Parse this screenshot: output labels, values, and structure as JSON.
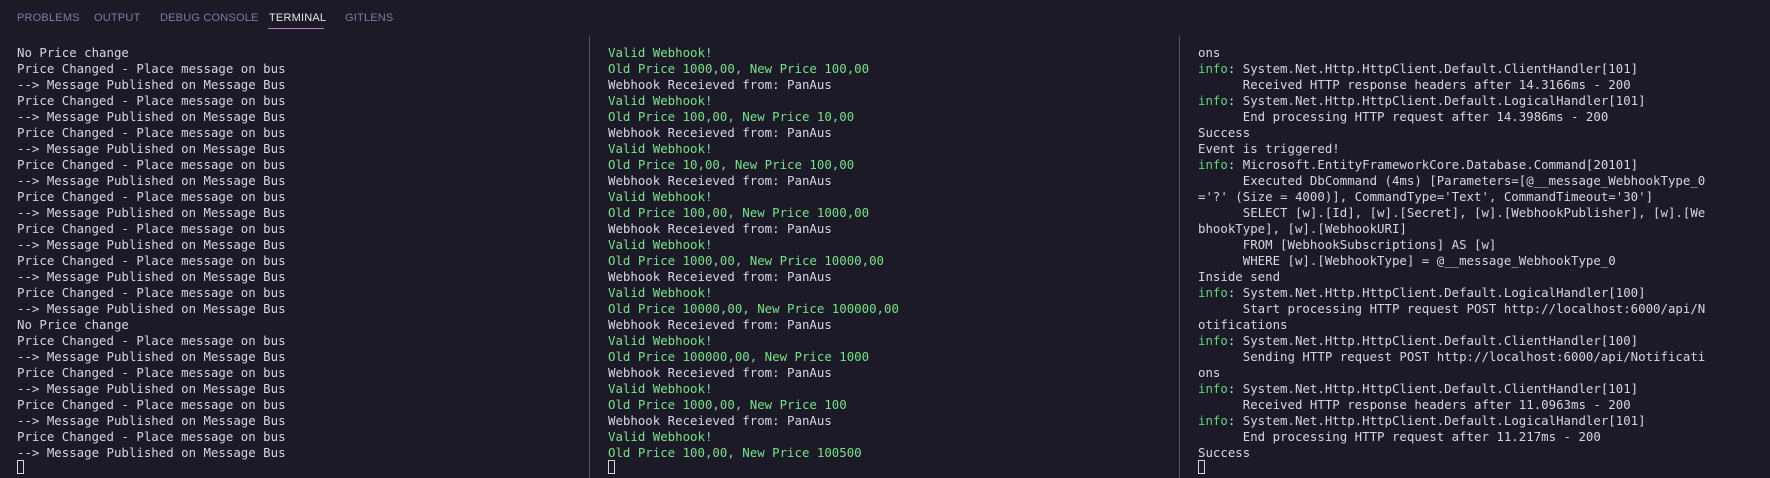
{
  "tabs": [
    {
      "label": "PROBLEMS"
    },
    {
      "label": "OUTPUT"
    },
    {
      "label": "DEBUG CONSOLE"
    },
    {
      "label": "TERMINAL"
    },
    {
      "label": "GITLENS"
    }
  ],
  "active_tab": "TERMINAL",
  "colors": {
    "background": "#1b1a26",
    "text": "#d6d6e0",
    "success_text": "#79e08a",
    "log_level": "#62d67a",
    "tab_inactive": "#7a7fa8",
    "tab_active": "#e8e8f0",
    "tab_underline": "#c66fd6",
    "divider": "#56516e"
  },
  "terminals": [
    {
      "lines": [
        {
          "text": "No Price change"
        },
        {
          "text": "Price Changed - Place message on bus"
        },
        {
          "text": "--> Message Published on Message Bus"
        },
        {
          "text": "Price Changed - Place message on bus"
        },
        {
          "text": "--> Message Published on Message Bus"
        },
        {
          "text": "Price Changed - Place message on bus"
        },
        {
          "text": "--> Message Published on Message Bus"
        },
        {
          "text": "Price Changed - Place message on bus"
        },
        {
          "text": "--> Message Published on Message Bus"
        },
        {
          "text": "Price Changed - Place message on bus"
        },
        {
          "text": "--> Message Published on Message Bus"
        },
        {
          "text": "Price Changed - Place message on bus"
        },
        {
          "text": "--> Message Published on Message Bus"
        },
        {
          "text": "Price Changed - Place message on bus"
        },
        {
          "text": "--> Message Published on Message Bus"
        },
        {
          "text": "Price Changed - Place message on bus"
        },
        {
          "text": "--> Message Published on Message Bus"
        },
        {
          "text": "No Price change"
        },
        {
          "text": "Price Changed - Place message on bus"
        },
        {
          "text": "--> Message Published on Message Bus"
        },
        {
          "text": "Price Changed - Place message on bus"
        },
        {
          "text": "--> Message Published on Message Bus"
        },
        {
          "text": "Price Changed - Place message on bus"
        },
        {
          "text": "--> Message Published on Message Bus"
        },
        {
          "text": "Price Changed - Place message on bus"
        },
        {
          "text": "--> Message Published on Message Bus"
        }
      ]
    },
    {
      "lines": [
        {
          "text": "Valid Webhook!",
          "style": "green"
        },
        {
          "text": "Old Price 1000,00, New Price 100,00",
          "style": "green"
        },
        {
          "text": "Webhook Receieved from: PanAus"
        },
        {
          "text": "Valid Webhook!",
          "style": "green"
        },
        {
          "text": "Old Price 100,00, New Price 10,00",
          "style": "green"
        },
        {
          "text": "Webhook Receieved from: PanAus"
        },
        {
          "text": "Valid Webhook!",
          "style": "green"
        },
        {
          "text": "Old Price 10,00, New Price 100,00",
          "style": "green"
        },
        {
          "text": "Webhook Receieved from: PanAus"
        },
        {
          "text": "Valid Webhook!",
          "style": "green"
        },
        {
          "text": "Old Price 100,00, New Price 1000,00",
          "style": "green"
        },
        {
          "text": "Webhook Receieved from: PanAus"
        },
        {
          "text": "Valid Webhook!",
          "style": "green"
        },
        {
          "text": "Old Price 1000,00, New Price 10000,00",
          "style": "green"
        },
        {
          "text": "Webhook Receieved from: PanAus"
        },
        {
          "text": "Valid Webhook!",
          "style": "green"
        },
        {
          "text": "Old Price 10000,00, New Price 100000,00",
          "style": "green"
        },
        {
          "text": "Webhook Receieved from: PanAus"
        },
        {
          "text": "Valid Webhook!",
          "style": "green"
        },
        {
          "text": "Old Price 100000,00, New Price 1000",
          "style": "green"
        },
        {
          "text": "Webhook Receieved from: PanAus"
        },
        {
          "text": "Valid Webhook!",
          "style": "green"
        },
        {
          "text": "Old Price 1000,00, New Price 100",
          "style": "green"
        },
        {
          "text": "Webhook Receieved from: PanAus"
        },
        {
          "text": "Valid Webhook!",
          "style": "green"
        },
        {
          "text": "Old Price 100,00, New Price 100500",
          "style": "green"
        }
      ]
    },
    {
      "lines": [
        {
          "text": "ons"
        },
        {
          "level": "info",
          "text": ": System.Net.Http.HttpClient.Default.ClientHandler[101]"
        },
        {
          "text": "      Received HTTP response headers after 14.3166ms - 200"
        },
        {
          "level": "info",
          "text": ": System.Net.Http.HttpClient.Default.LogicalHandler[101]"
        },
        {
          "text": "      End processing HTTP request after 14.3986ms - 200"
        },
        {
          "text": "Success"
        },
        {
          "text": "Event is triggered!"
        },
        {
          "level": "info",
          "text": ": Microsoft.EntityFrameworkCore.Database.Command[20101]"
        },
        {
          "text": "      Executed DbCommand (4ms) [Parameters=[@__message_WebhookType_0"
        },
        {
          "text": "='?' (Size = 4000)], CommandType='Text', CommandTimeout='30']"
        },
        {
          "text": "      SELECT [w].[Id], [w].[Secret], [w].[WebhookPublisher], [w].[We"
        },
        {
          "text": "bhookType], [w].[WebhookURI]"
        },
        {
          "text": "      FROM [WebhookSubscriptions] AS [w]"
        },
        {
          "text": "      WHERE [w].[WebhookType] = @__message_WebhookType_0"
        },
        {
          "text": "Inside send"
        },
        {
          "level": "info",
          "text": ": System.Net.Http.HttpClient.Default.LogicalHandler[100]"
        },
        {
          "text": "      Start processing HTTP request POST http://localhost:6000/api/N"
        },
        {
          "text": "otifications"
        },
        {
          "level": "info",
          "text": ": System.Net.Http.HttpClient.Default.ClientHandler[100]"
        },
        {
          "text": "      Sending HTTP request POST http://localhost:6000/api/Notificati"
        },
        {
          "text": "ons"
        },
        {
          "level": "info",
          "text": ": System.Net.Http.HttpClient.Default.ClientHandler[101]"
        },
        {
          "text": "      Received HTTP response headers after 11.0963ms - 200"
        },
        {
          "level": "info",
          "text": ": System.Net.Http.HttpClient.Default.LogicalHandler[101]"
        },
        {
          "text": "      End processing HTTP request after 11.217ms - 200"
        },
        {
          "text": "Success"
        }
      ]
    }
  ]
}
